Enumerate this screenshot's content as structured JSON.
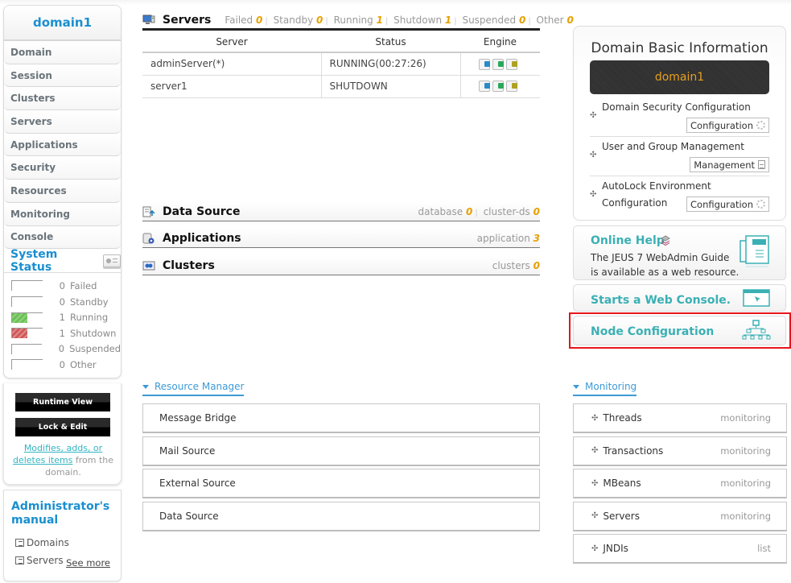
{
  "sidebar": {
    "domain_name": "domain1",
    "nav_items": [
      {
        "label": "Domain"
      },
      {
        "label": "Session"
      },
      {
        "label": "Clusters"
      },
      {
        "label": "Servers"
      },
      {
        "label": "Applications"
      },
      {
        "label": "Security"
      },
      {
        "label": "Resources"
      },
      {
        "label": "Monitoring"
      },
      {
        "label": "Console"
      }
    ],
    "system_status": {
      "title": "System Status",
      "rows": [
        {
          "count": "0",
          "label": "Failed",
          "fill": 0
        },
        {
          "count": "0",
          "label": "Standby",
          "fill": 0
        },
        {
          "count": "1",
          "label": "Running",
          "fill": 0.5,
          "color": "#6cbf58"
        },
        {
          "count": "1",
          "label": "Shutdown",
          "fill": 0.5,
          "color": "#cf5858"
        },
        {
          "count": "0",
          "label": "Suspended",
          "fill": 0
        },
        {
          "count": "0",
          "label": "Other",
          "fill": 0
        }
      ]
    },
    "mode": {
      "runtime_view": "Runtime View",
      "lock_edit": "Lock & Edit",
      "desc_link": "Modifies, adds, or deletes items",
      "desc_rest": " from the domain."
    },
    "manual": {
      "title": "Administrator's manual",
      "links": [
        "Domains",
        "Servers"
      ],
      "see_more": "See more"
    }
  },
  "servers": {
    "title": "Servers",
    "stats": [
      {
        "label": "Failed",
        "value": "0"
      },
      {
        "label": "Standby",
        "value": "0"
      },
      {
        "label": "Running",
        "value": "1"
      },
      {
        "label": "Shutdown",
        "value": "1"
      },
      {
        "label": "Suspended",
        "value": "0"
      },
      {
        "label": "Other",
        "value": "0"
      }
    ],
    "columns": [
      "Server",
      "Status",
      "Engine"
    ],
    "rows": [
      {
        "server": "adminServer(*)",
        "status": "RUNNING(00:27:26)"
      },
      {
        "server": "server1",
        "status": "SHUTDOWN"
      }
    ]
  },
  "data_source": {
    "title": "Data Source",
    "stats": [
      {
        "label": "database",
        "value": "0"
      },
      {
        "label": "cluster-ds",
        "value": "0"
      }
    ]
  },
  "applications": {
    "title": "Applications",
    "stats": [
      {
        "label": "application",
        "value": "3"
      }
    ]
  },
  "clusters": {
    "title": "Clusters",
    "stats": [
      {
        "label": "clusters",
        "value": "0"
      }
    ]
  },
  "resource_manager": {
    "title": "Resource Manager",
    "items": [
      "Message Bridge",
      "Mail Source",
      "External Source",
      "Data Source"
    ]
  },
  "domain_info": {
    "title": "Domain Basic Information",
    "domain": "domain1",
    "rows": [
      {
        "label": "Domain Security Configuration",
        "button": "Configuration"
      },
      {
        "label": "User and Group Management",
        "button": "Management"
      },
      {
        "label_line1": "AutoLock Environment",
        "label_line2": "Configuration",
        "button": "Configuration"
      }
    ]
  },
  "cards": {
    "online_help": {
      "title": "Online Help",
      "desc1": "The JEUS 7 WebAdmin Guide",
      "desc2": "is available as a web resource."
    },
    "web_console": {
      "title": "Starts a Web Console."
    },
    "node_config": {
      "title": "Node Configuration"
    }
  },
  "monitoring": {
    "title": "Monitoring",
    "items": [
      {
        "label": "Threads",
        "tag": "monitoring"
      },
      {
        "label": "Transactions",
        "tag": "monitoring"
      },
      {
        "label": "MBeans",
        "tag": "monitoring"
      },
      {
        "label": "Servers",
        "tag": "monitoring"
      },
      {
        "label": "JNDIs",
        "tag": "list"
      }
    ]
  },
  "colors": {
    "accent": "#1a8fd0",
    "count": "#e8a000",
    "teal": "#3ab0b4",
    "highlight": "#e8141b"
  }
}
